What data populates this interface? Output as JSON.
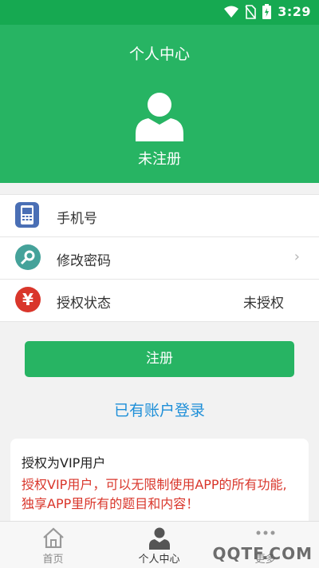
{
  "status_bar": {
    "time": "3:29"
  },
  "header": {
    "title": "个人中心",
    "username": "未注册"
  },
  "list": [
    {
      "label": "手机号",
      "value": "",
      "icon": "phone-icon",
      "icon_color": "#4a6fb5"
    },
    {
      "label": "修改密码",
      "value": "",
      "icon": "key-icon",
      "icon_color": "#45a29a",
      "has_arrow": true
    },
    {
      "label": "授权状态",
      "value": "未授权",
      "icon": "yuan-icon",
      "icon_color": "#d9362b"
    }
  ],
  "register_button": "注册",
  "login_link": "已有账户登录",
  "vip_card": {
    "title": "授权为VIP用户",
    "description": "授权VIP用户，可以无限制使用APP的所有功能, 独享APP里所有的题目和内容！"
  },
  "tabs": [
    {
      "label": "首页",
      "icon": "home-icon",
      "active": false
    },
    {
      "label": "个人中心",
      "icon": "user-icon",
      "active": true
    },
    {
      "label": "更多",
      "icon": "more-icon",
      "active": false
    }
  ],
  "watermark": "QQTF.COM",
  "colors": {
    "primary": "#27b463",
    "link": "#1e8fd8",
    "warning_text": "#d9362b"
  }
}
